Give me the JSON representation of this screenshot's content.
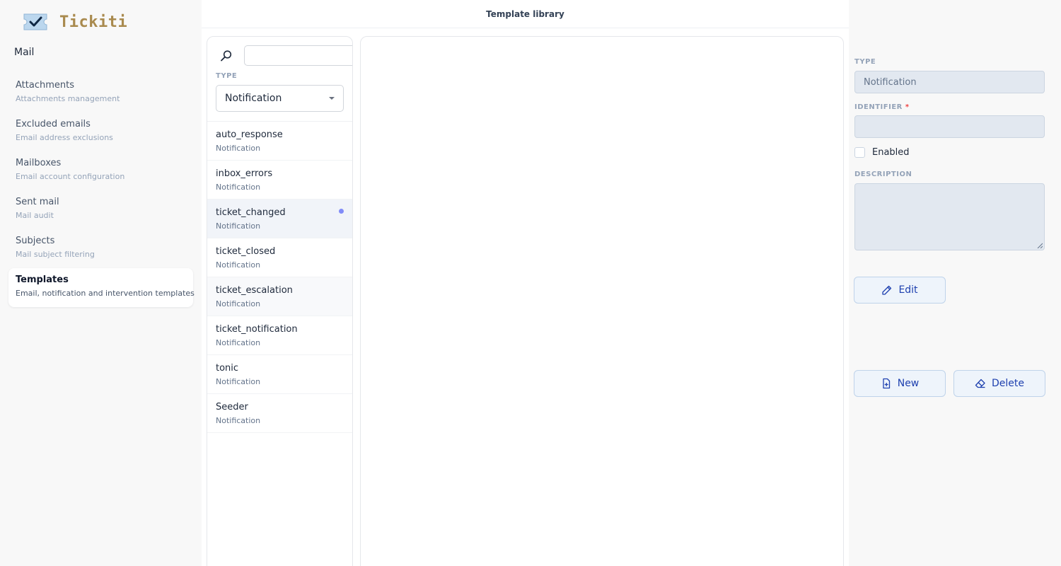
{
  "app": {
    "logo_text": "Tickiti"
  },
  "sidebar": {
    "section_title": "Mail",
    "items": [
      {
        "label": "Attachments",
        "sub": "Attachments management"
      },
      {
        "label": "Excluded emails",
        "sub": "Email address exclusions"
      },
      {
        "label": "Mailboxes",
        "sub": "Email account configuration"
      },
      {
        "label": "Sent mail",
        "sub": "Mail audit"
      },
      {
        "label": "Subjects",
        "sub": "Mail subject filtering"
      },
      {
        "label": "Templates",
        "sub": "Email, notification and intervention templates",
        "active": true
      }
    ]
  },
  "header": {
    "title": "Template library"
  },
  "list_panel": {
    "search": {
      "value": "",
      "placeholder": ""
    },
    "type_label": "TYPE",
    "type_value": "Notification",
    "items": [
      {
        "name": "auto_response",
        "type": "Notification"
      },
      {
        "name": "inbox_errors",
        "type": "Notification"
      },
      {
        "name": "ticket_changed",
        "type": "Notification",
        "selected": true,
        "modified": true
      },
      {
        "name": "ticket_closed",
        "type": "Notification"
      },
      {
        "name": "ticket_escalation",
        "type": "Notification"
      },
      {
        "name": "ticket_notification",
        "type": "Notification"
      },
      {
        "name": "tonic",
        "type": "Notification"
      },
      {
        "name": "Seeder",
        "type": "Notification"
      }
    ]
  },
  "details": {
    "type_label": "TYPE",
    "type_value": "Notification",
    "identifier_label": "IDENTIFIER",
    "identifier_required_mark": "*",
    "identifier_value": "",
    "enabled_label": "Enabled",
    "enabled_checked": false,
    "description_label": "DESCRIPTION",
    "description_value": "",
    "edit_label": "Edit",
    "new_label": "New",
    "delete_label": "Delete"
  },
  "colors": {
    "accent": "#1e40af",
    "logo": "#a98a4e",
    "modified_dot": "#818cf8",
    "sidebar_bg": "#f8f8f8"
  }
}
